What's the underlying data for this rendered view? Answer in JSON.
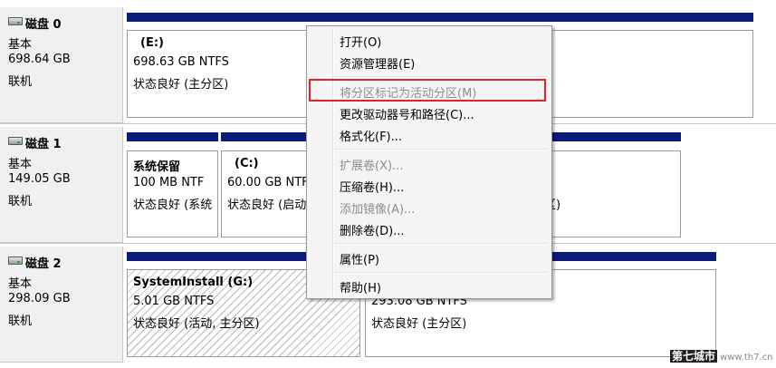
{
  "disks": [
    {
      "name": "磁盘 0",
      "type": "基本",
      "size": "698.64 GB",
      "status": "联机"
    },
    {
      "name": "磁盘 1",
      "type": "基本",
      "size": "149.05 GB",
      "status": "联机"
    },
    {
      "name": "磁盘 2",
      "type": "基本",
      "size": "298.09 GB",
      "status": "联机"
    }
  ],
  "partitions": {
    "e": {
      "title": "(E:)",
      "fs": "698.63 GB NTFS",
      "state": "状态良好 (主分区)"
    },
    "reserved": {
      "title": "系统保留",
      "fs": "100 MB NTF",
      "state": "状态良好 (系统"
    },
    "c": {
      "title": "(C:)",
      "fs": "60.00 GB NTF",
      "state": "状态良好 (启动",
      "state_tail": "区)"
    },
    "g": {
      "title": "SystemInstall  (G:)",
      "fs": "5.01 GB NTFS",
      "state": "状态良好 (活动, 主分区)"
    },
    "d2": {
      "fs": "293.08 GB NTFS",
      "state": "状态良好 (主分区)"
    }
  },
  "context_menu": {
    "open": "打开(O)",
    "explorer": "资源管理器(E)",
    "mark_active": "将分区标记为活动分区(M)",
    "change_letter": "更改驱动器号和路径(C)...",
    "format": "格式化(F)...",
    "extend": "扩展卷(X)...",
    "shrink": "压缩卷(H)...",
    "add_mirror": "添加镜像(A)...",
    "delete": "删除卷(D)...",
    "properties": "属性(P)",
    "help": "帮助(H)"
  },
  "watermark": {
    "brand": "第七城市",
    "url": "www.th7.cn"
  }
}
